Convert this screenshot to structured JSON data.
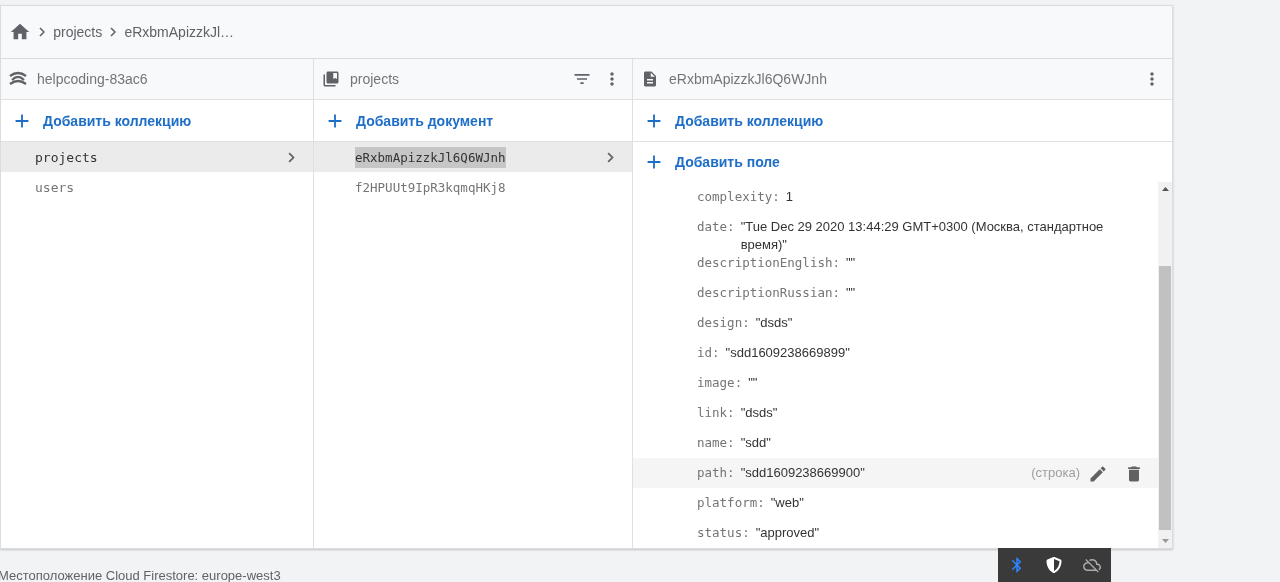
{
  "breadcrumb": [
    "projects",
    "eRxbmApizzkJl…"
  ],
  "columns": [
    {
      "kind": "root",
      "title": "helpcoding-83ac6",
      "add_label": "Добавить коллекцию",
      "items": [
        {
          "label": "projects",
          "selected": true
        },
        {
          "label": "users",
          "selected": false
        }
      ]
    },
    {
      "kind": "collection",
      "title": "projects",
      "add_label": "Добавить документ",
      "items": [
        {
          "label": "eRxbmApizzkJl6Q6WJnh",
          "selected": true
        },
        {
          "label": "f2HPUUt9IpR3kqmqHKj8",
          "selected": false
        }
      ]
    },
    {
      "kind": "document",
      "title": "eRxbmApizzkJl6Q6WJnh",
      "add_label": "Добавить коллекцию",
      "add_field_label": "Добавить поле"
    }
  ],
  "fields": [
    {
      "key": "complexity:",
      "value": "1",
      "highlighted": false
    },
    {
      "key": "date:",
      "value": "\"Tue Dec 29 2020 13:44:29 GMT+0300 (Москва, стандартное время)\"",
      "highlighted": false
    },
    {
      "key": "descriptionEnglish:",
      "value": "\"\"",
      "highlighted": false
    },
    {
      "key": "descriptionRussian:",
      "value": "\"\"",
      "highlighted": false
    },
    {
      "key": "design:",
      "value": "\"dsds\"",
      "highlighted": false
    },
    {
      "key": "id:",
      "value": "\"sdd1609238669899\"",
      "highlighted": false
    },
    {
      "key": "image:",
      "value": "\"\"",
      "highlighted": false
    },
    {
      "key": "link:",
      "value": "\"dsds\"",
      "highlighted": false
    },
    {
      "key": "name:",
      "value": "\"sdd\"",
      "highlighted": false
    },
    {
      "key": "path:",
      "value": "\"sdd1609238669900\"",
      "highlighted": true,
      "type_label": "(строка)"
    },
    {
      "key": "platform:",
      "value": "\"web\"",
      "highlighted": false
    },
    {
      "key": "status:",
      "value": "\"approved\"",
      "highlighted": false
    }
  ],
  "footer": "Местоположение Cloud Firestore: europe-west3"
}
